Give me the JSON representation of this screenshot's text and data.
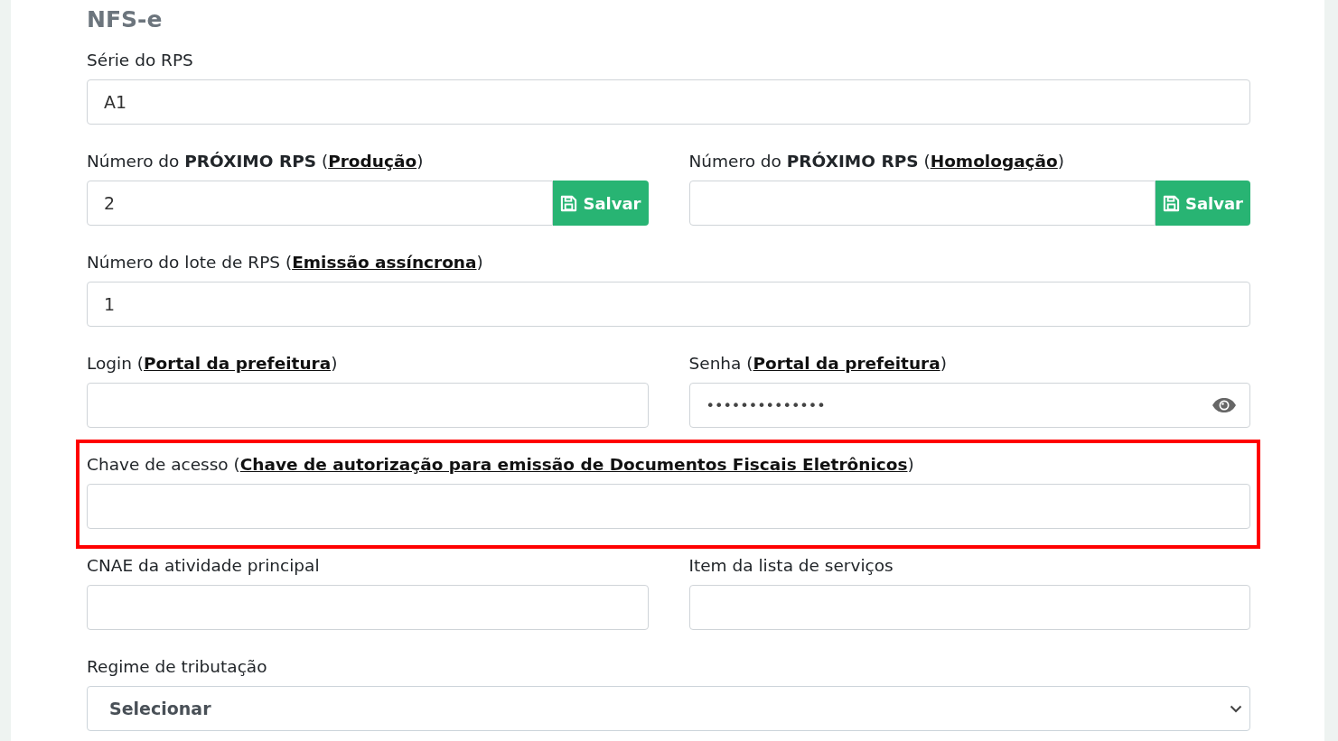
{
  "section_title": "NFS-e",
  "rows": [
    {
      "highlighted": false,
      "fields": [
        {
          "kind": "text",
          "label": "Série do RPS",
          "value": "A1"
        }
      ]
    },
    {
      "highlighted": false,
      "fields": [
        {
          "kind": "text_with_button",
          "label": "Número do **PRÓXIMO RPS** (",
          "link": "Produção",
          "label_end": ")",
          "value": "2",
          "button": "Salvar"
        },
        {
          "kind": "text_with_button",
          "label": "Número do **PRÓXIMO RPS** (",
          "link": "Homologação",
          "label_end": ")",
          "button": "Salvar"
        }
      ]
    },
    {
      "highlighted": false,
      "fields": [
        {
          "kind": "text",
          "label": "Número do lote de RPS (",
          "link": "Emissão assíncrona",
          "label_end": ")",
          "value": "1"
        }
      ]
    },
    {
      "highlighted": false,
      "fields": [
        {
          "kind": "text",
          "label": "Login (",
          "link": "Portal da prefeitura",
          "label_end": ")"
        },
        {
          "kind": "password",
          "label": "Senha (",
          "link": "Portal da prefeitura",
          "label_end": ")",
          "value": "••••••••••••••"
        }
      ]
    },
    {
      "highlighted": true,
      "fields": [
        {
          "kind": "text",
          "label": "Chave de acesso (",
          "link": "Chave de autorização para emissão de Documentos Fiscais Eletrônicos",
          "label_end": ")"
        }
      ]
    },
    {
      "highlighted": false,
      "fields": [
        {
          "kind": "text",
          "label": "CNAE da atividade principal"
        },
        {
          "kind": "text",
          "label": "Item da lista de serviços"
        }
      ]
    },
    {
      "highlighted": false,
      "fields": [
        {
          "kind": "select",
          "label": "Regime de tributação",
          "value": "Selecionar"
        }
      ]
    }
  ]
}
